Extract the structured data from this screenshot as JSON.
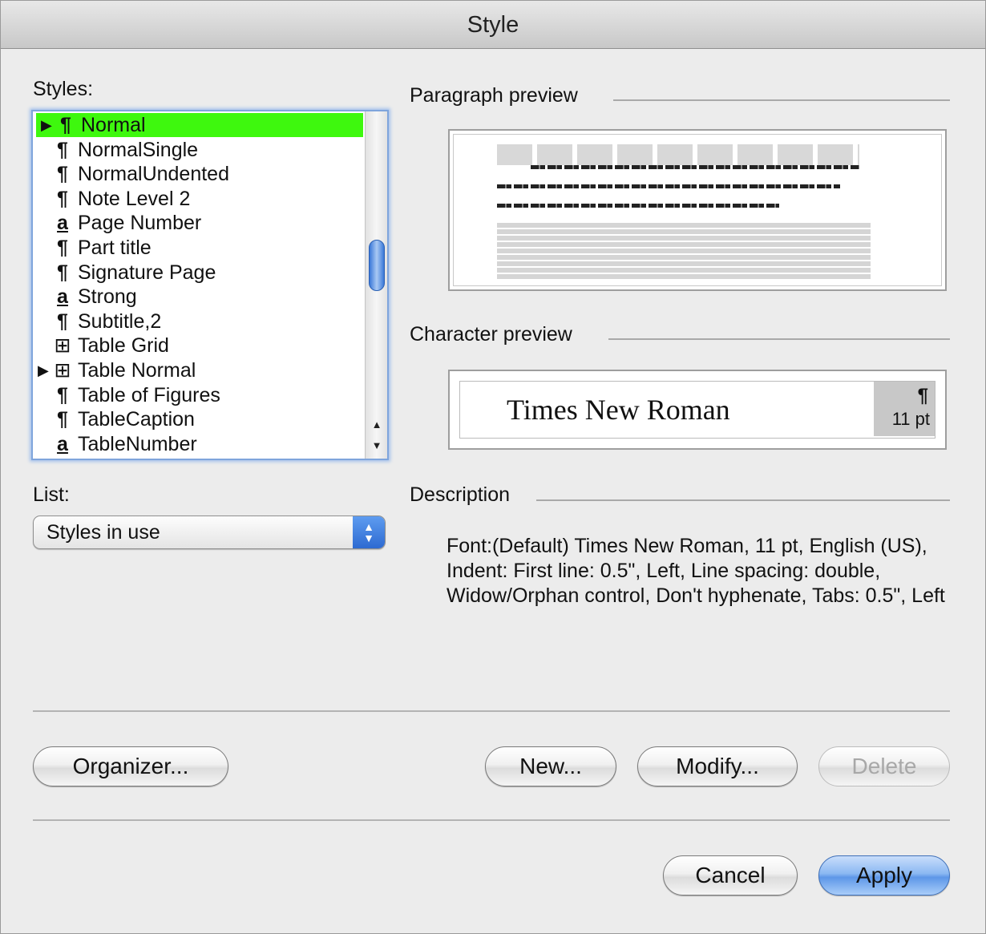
{
  "window": {
    "title": "Style"
  },
  "styles_panel": {
    "label": "Styles:",
    "items": [
      {
        "label": "Normal",
        "icon": "¶",
        "icon_name": "paragraph-style-icon",
        "expand": "▶",
        "selected": true
      },
      {
        "label": "NormalSingle",
        "icon": "¶",
        "icon_name": "paragraph-style-icon",
        "expand": ""
      },
      {
        "label": "NormalUndented",
        "icon": "¶",
        "icon_name": "paragraph-style-icon",
        "expand": ""
      },
      {
        "label": "Note Level 2",
        "icon": "¶",
        "icon_name": "paragraph-style-icon",
        "expand": ""
      },
      {
        "label": "Page Number",
        "icon": "a",
        "icon_name": "character-style-icon",
        "expand": ""
      },
      {
        "label": "Part title",
        "icon": "¶",
        "icon_name": "paragraph-style-icon",
        "expand": ""
      },
      {
        "label": "Signature Page",
        "icon": "¶",
        "icon_name": "paragraph-style-icon",
        "expand": ""
      },
      {
        "label": "Strong",
        "icon": "a",
        "icon_name": "character-style-icon",
        "expand": ""
      },
      {
        "label": "Subtitle,2",
        "icon": "¶",
        "icon_name": "paragraph-style-icon",
        "expand": ""
      },
      {
        "label": "Table Grid",
        "icon": "⊞",
        "icon_name": "table-style-icon",
        "expand": ""
      },
      {
        "label": "Table Normal",
        "icon": "⊞",
        "icon_name": "table-style-icon",
        "expand": "▶"
      },
      {
        "label": "Table of Figures",
        "icon": "¶",
        "icon_name": "paragraph-style-icon",
        "expand": ""
      },
      {
        "label": "TableCaption",
        "icon": "¶",
        "icon_name": "paragraph-style-icon",
        "expand": ""
      },
      {
        "label": "TableNumber",
        "icon": "a",
        "icon_name": "character-style-icon",
        "expand": ""
      }
    ],
    "scroll_up_glyph": "▲",
    "scroll_down_glyph": "▼"
  },
  "list_panel": {
    "label": "List:",
    "selected": "Styles in use",
    "stepper_up": "▲",
    "stepper_down": "▼"
  },
  "paragraph_preview": {
    "label": "Paragraph preview"
  },
  "character_preview": {
    "label": "Character preview",
    "font_name": "Times New Roman",
    "pilcrow": "¶",
    "size": "11 pt"
  },
  "description": {
    "label": "Description",
    "text": "Font:(Default) Times New Roman, 11 pt, English (US), Indent: First line:  0.5\", Left, Line spacing: double, Widow/Orphan control, Don't hyphenate, Tabs: 0.5\", Left"
  },
  "buttons": {
    "organizer": "Organizer...",
    "new": "New...",
    "modify": "Modify...",
    "delete": "Delete",
    "cancel": "Cancel",
    "apply": "Apply"
  },
  "colors": {
    "selection": "#3ef80e",
    "focus_ring": "#7fa5dc",
    "default_button": "#5d97e8"
  }
}
